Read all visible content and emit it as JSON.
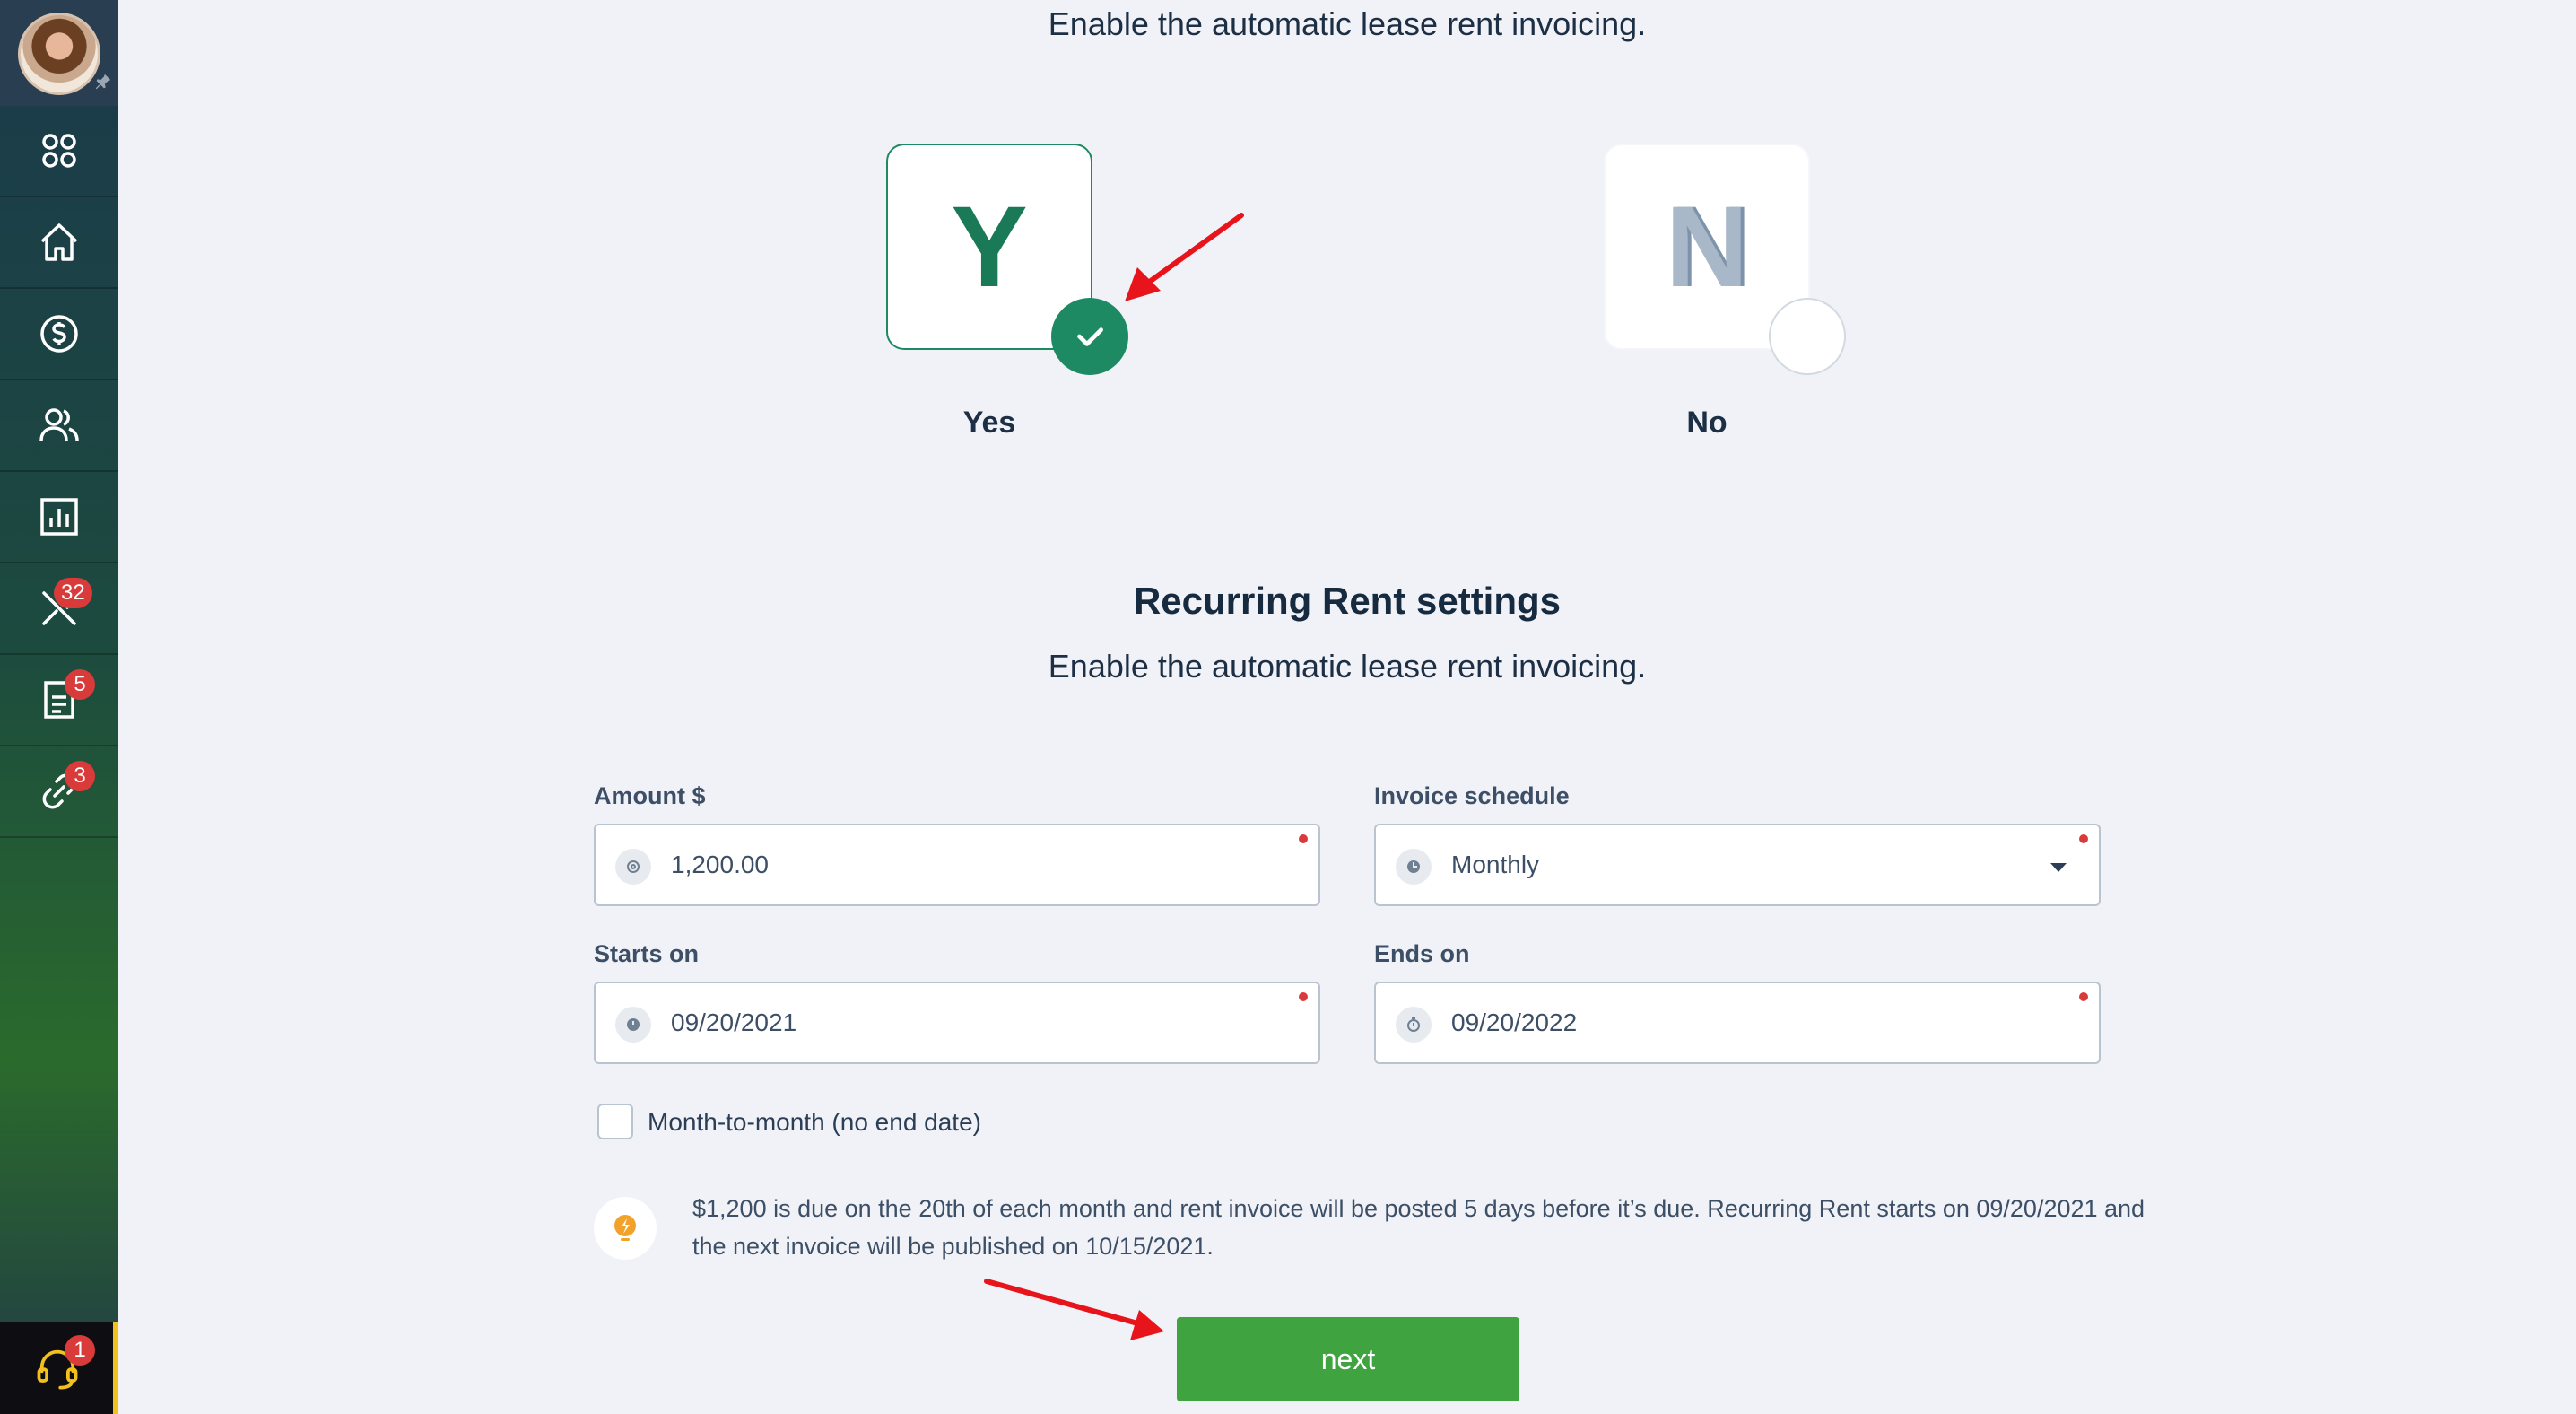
{
  "sidebar": {
    "badges": {
      "maintenance": "32",
      "documents": "5",
      "links": "3",
      "support": "1"
    },
    "icons": [
      "apps-icon",
      "home-icon",
      "dollar-icon",
      "users-icon",
      "reports-icon",
      "tools-icon",
      "document-icon",
      "link-icon",
      "headset-icon"
    ]
  },
  "header_subtitle": "Enable the automatic lease rent invoicing.",
  "choices": {
    "yes": {
      "letter": "Y",
      "label": "Yes",
      "selected": true
    },
    "no": {
      "letter": "N",
      "label": "No",
      "selected": false
    }
  },
  "section": {
    "title": "Recurring Rent settings",
    "subtitle": "Enable the automatic lease rent invoicing."
  },
  "form": {
    "amount": {
      "label": "Amount $",
      "value": "1,200.00"
    },
    "schedule": {
      "label": "Invoice schedule",
      "value": "Monthly"
    },
    "starts_on": {
      "label": "Starts on",
      "value": "09/20/2021"
    },
    "ends_on": {
      "label": "Ends on",
      "value": "09/20/2022"
    },
    "month_to_month": {
      "label": "Month-to-month (no end date)",
      "checked": false
    }
  },
  "tip": {
    "text": "$1,200 is due on the 20th of each month and rent invoice will be posted 5 days before it’s due. Recurring Rent starts on 09/20/2021 and the next invoice will be published on 10/15/2021."
  },
  "next_button": "next",
  "colors": {
    "accent_green": "#1e8a63",
    "button_green": "#3fa33f",
    "badge_red": "#d93b3b",
    "annotation_red": "#e8141b"
  }
}
